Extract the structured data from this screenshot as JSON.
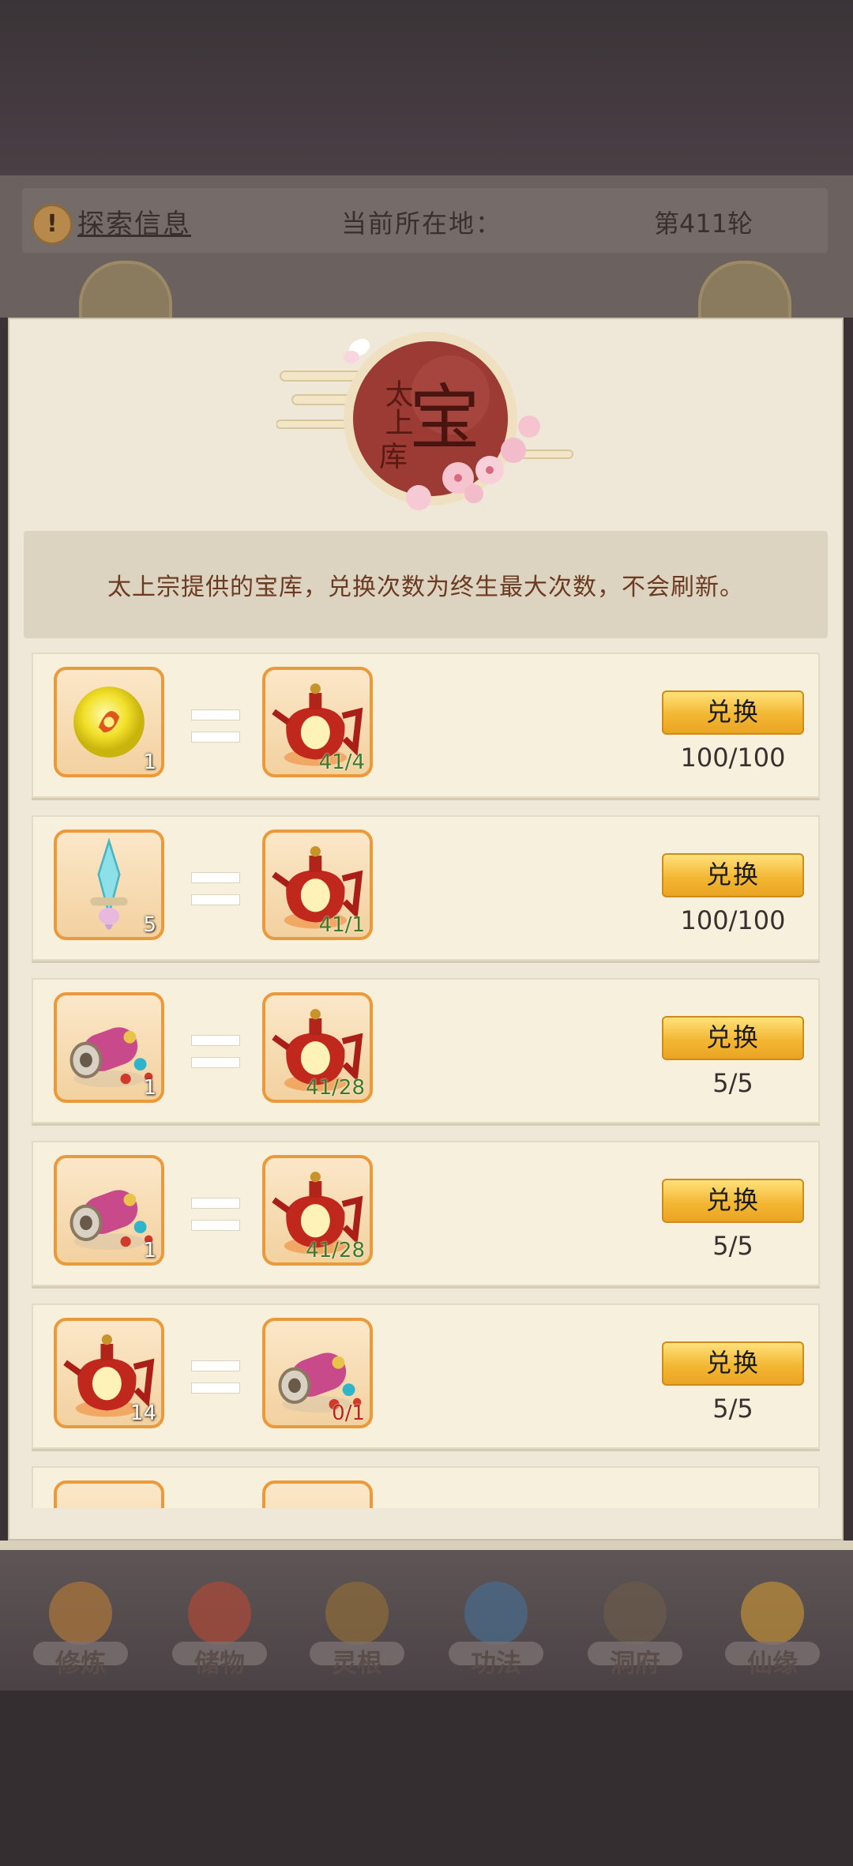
{
  "header": {
    "explore_label": "探索信息",
    "location_label": "当前所在地：",
    "round_label": "第411轮"
  },
  "dialog": {
    "emblem": {
      "top_text": "太上",
      "main_char": "宝",
      "bottom_char": "库"
    },
    "description": "太上宗提供的宝库，兑换次数为终生最大次数，不会刷新。",
    "rows": [
      {
        "give_icon": "golden-orb-icon",
        "give_count": "1",
        "get_icon": "red-wine-pot-icon",
        "get_count": "41/4",
        "count_color": "green",
        "button_label": "兑换",
        "limit": "100/100"
      },
      {
        "give_icon": "jade-sword-icon",
        "give_count": "5",
        "get_icon": "red-wine-pot-icon",
        "get_count": "41/1",
        "count_color": "green",
        "button_label": "兑换",
        "limit": "100/100"
      },
      {
        "give_icon": "jeweled-drum-icon",
        "give_count": "1",
        "get_icon": "red-wine-pot-icon",
        "get_count": "41/28",
        "count_color": "green",
        "button_label": "兑换",
        "limit": "5/5"
      },
      {
        "give_icon": "jeweled-drum-icon",
        "give_count": "1",
        "get_icon": "red-wine-pot-icon",
        "get_count": "41/28",
        "count_color": "green",
        "button_label": "兑换",
        "limit": "5/5"
      },
      {
        "give_icon": "red-wine-pot-icon",
        "give_count": "14",
        "get_icon": "jeweled-drum-icon",
        "get_count": "0/1",
        "count_color": "red",
        "button_label": "兑换",
        "limit": "5/5"
      }
    ]
  },
  "nav": {
    "items": [
      {
        "label": "修炼",
        "icon": "cultivator-icon",
        "color": "#a8743c"
      },
      {
        "label": "储物",
        "icon": "storage-bag-icon",
        "color": "#a8493a"
      },
      {
        "label": "灵根",
        "icon": "spirit-root-icon",
        "color": "#8a6a3a"
      },
      {
        "label": "功法",
        "icon": "technique-book-icon",
        "color": "#4a6a8a"
      },
      {
        "label": "洞府",
        "icon": "cave-dwelling-icon",
        "color": "#6a5a4a"
      },
      {
        "label": "仙缘",
        "icon": "immortal-fate-icon",
        "color": "#b88a3a"
      }
    ]
  },
  "colors": {
    "accent": "#f3b734",
    "count_green": "#3f7a2a",
    "count_red": "#c0221a",
    "desc_text": "#6b3a22"
  }
}
